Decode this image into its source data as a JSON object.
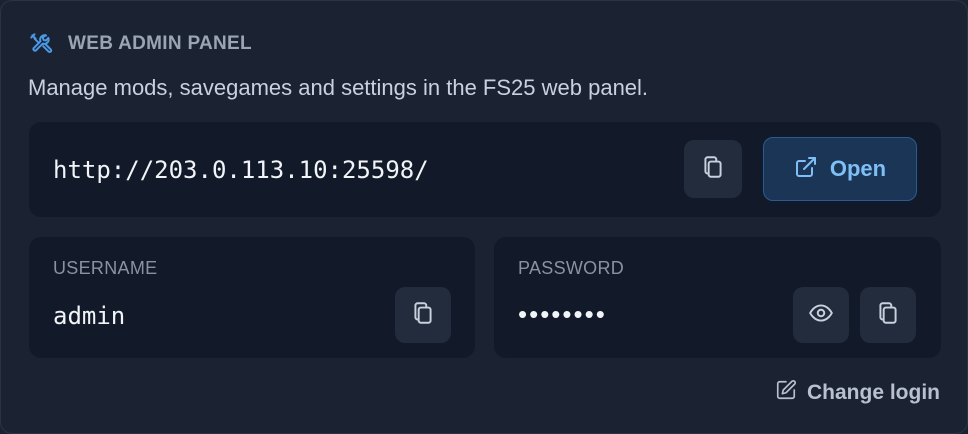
{
  "header": {
    "icon": "tools-icon",
    "title": "WEB ADMIN PANEL"
  },
  "description": "Manage mods, savegames and settings in the FS25 web panel.",
  "url_section": {
    "url": "http://203.0.113.10:25598/",
    "copy_icon": "copy-icon",
    "open_icon": "external-link-icon",
    "open_label": "Open"
  },
  "username": {
    "label": "USERNAME",
    "value": "admin",
    "copy_icon": "copy-icon"
  },
  "password": {
    "label": "PASSWORD",
    "masked_value": "••••••••",
    "reveal_icon": "eye-icon",
    "copy_icon": "copy-icon"
  },
  "change_login": {
    "icon": "pencil-icon",
    "label": "Change login"
  },
  "colors": {
    "background": "#1b2333",
    "panel": "#121a29",
    "accent": "#7fbff5",
    "accent_bg": "#1a3556"
  }
}
